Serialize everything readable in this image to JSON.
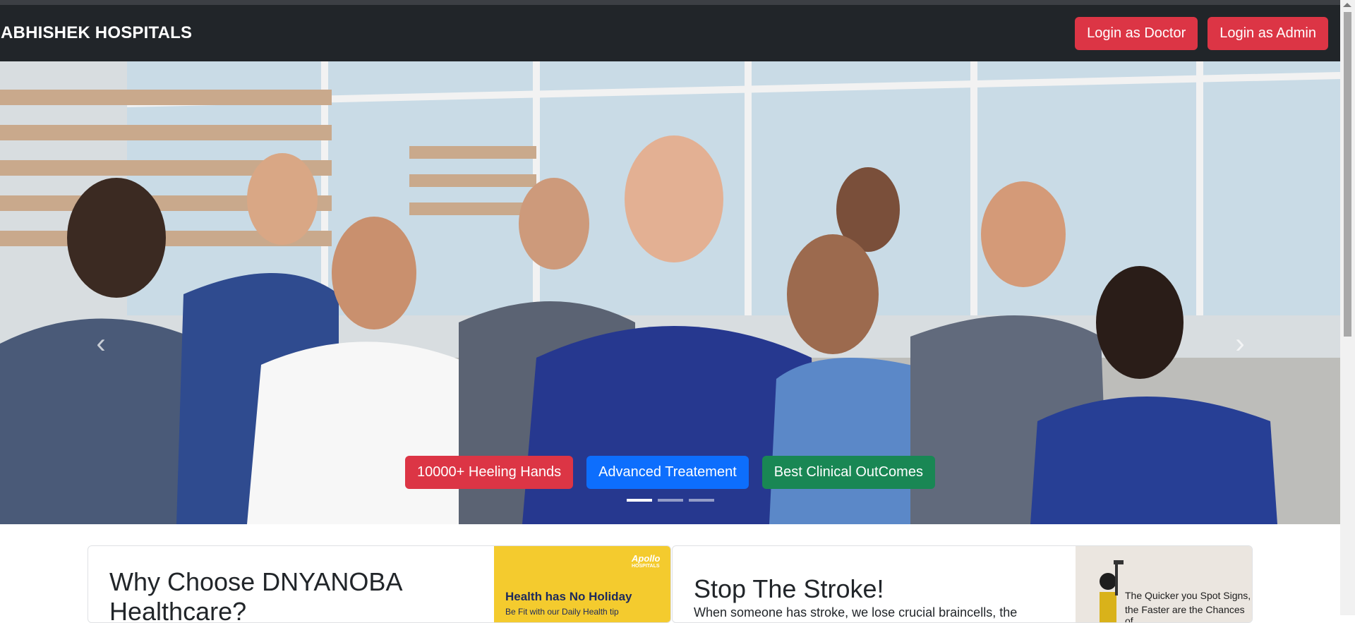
{
  "navbar": {
    "brand": "ABHISHEK HOSPITALS",
    "login_doctor": "Login as Doctor",
    "login_admin": "Login as Admin"
  },
  "carousel": {
    "caption_buttons": [
      "10000+ Heeling Hands",
      "Advanced Treatement",
      "Best Clinical OutComes"
    ],
    "indicators": 3,
    "active_indicator": 0,
    "prev_label": "‹",
    "next_label": "›"
  },
  "cards": [
    {
      "title": "Why Choose DNYANOBA Healthcare?",
      "image_brand": "Apollo",
      "image_brand_sub": "HOSPITALS",
      "image_headline": "Health has No Holiday",
      "image_sub": "Be Fit with our Daily Health tip"
    },
    {
      "title": "Stop The Stroke!",
      "text": "When someone has stroke, we lose crucial braincells, the",
      "image_text_line1": "The Quicker you Spot Signs,",
      "image_text_line2": "the Faster are the Chances of"
    }
  ],
  "colors": {
    "navbar_bg": "#212529",
    "danger": "#dc3545",
    "primary": "#0d6efd",
    "success": "#198754"
  }
}
